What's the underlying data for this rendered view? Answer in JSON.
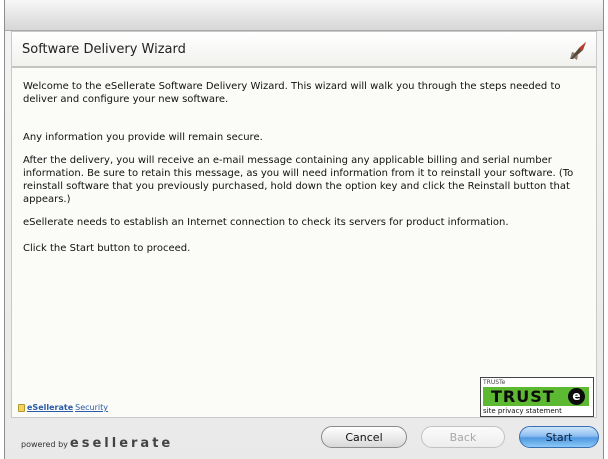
{
  "wizard": {
    "title": "Software Delivery Wizard",
    "icon": "rocket-icon"
  },
  "content": {
    "paragraphs": [
      "Welcome to the eSellerate Software Delivery Wizard. This wizard will walk you through the steps needed to deliver and configure your new software.",
      "Any information you provide will remain secure.",
      "After the delivery, you will receive an e-mail message containing any applicable billing and serial number information. Be sure to retain this message, as you will need information from it to reinstall your software. (To reinstall software that you previously purchased, hold down the option key and click the Reinstall button that appears.)",
      "eSellerate needs to establish an Internet connection to check its servers for product information.",
      "Click the Start button to proceed."
    ]
  },
  "security_link": {
    "brand": "eSellerate",
    "label": "Security"
  },
  "truste": {
    "top_text": "TRUSTe",
    "word": "TRUST",
    "mark": "e",
    "bottom_text": "site privacy statement"
  },
  "footer": {
    "powered_by": "powered by",
    "logo": "esellerate"
  },
  "buttons": {
    "cancel": "Cancel",
    "back": "Back",
    "start": "Start"
  },
  "colors": {
    "start_button": "#4f97e0",
    "truste_green": "#5db832",
    "link_blue": "#2a5aa8"
  }
}
